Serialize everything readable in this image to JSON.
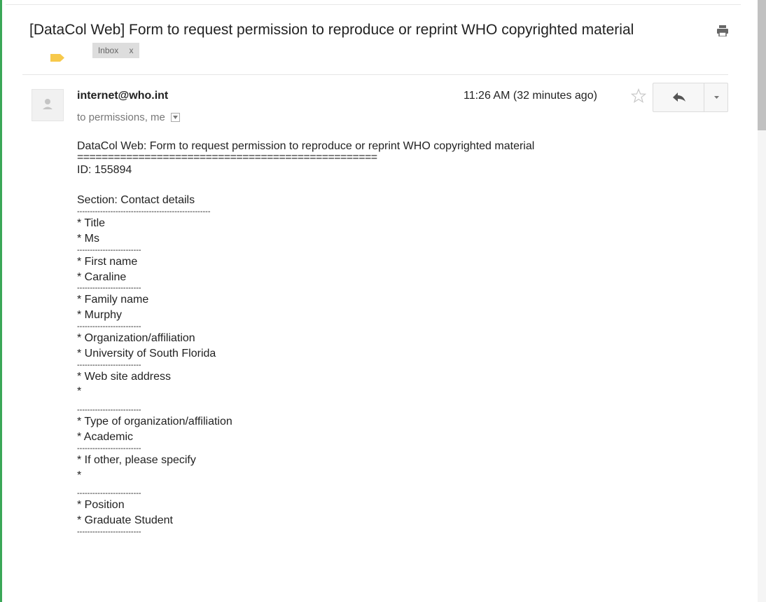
{
  "email": {
    "subject": "[DataCol Web] Form to request permission to reproduce or reprint WHO copyrighted material",
    "inbox_label": "Inbox",
    "inbox_remove": "x",
    "sender": "internet@who.int",
    "recipients": "to permissions, me",
    "time": "11:26 AM (32 minutes ago)",
    "body_heading": "DataCol Web: Form to request permission to reproduce or reprint WHO copyrighted material",
    "double_rule": "=================================================",
    "id_line": "ID: 155894",
    "section_line": "Section: Contact details",
    "section_rule": "----------------------------------------------------",
    "fields": [
      {
        "label": "* Title",
        "value": "* Ms"
      },
      {
        "label": "* First name",
        "value": "* Caraline"
      },
      {
        "label": "* Family name",
        "value": "* Murphy"
      },
      {
        "label": "* Organization/affiliation",
        "value": "* University of South Florida"
      },
      {
        "label": "* Web site address",
        "value": "*"
      },
      {
        "label": "* Type of organization/affiliation",
        "value": "* Academic"
      },
      {
        "label": "* If other, please specify",
        "value": "*"
      },
      {
        "label": "* Position",
        "value": "* Graduate Student"
      }
    ],
    "field_rule": "-------------------------"
  },
  "icons": {
    "label_tag": "label-tag-icon",
    "print": "print-icon",
    "avatar": "person-icon",
    "star": "star-icon",
    "reply": "reply-icon",
    "more": "chevron-down-icon"
  },
  "colors": {
    "accent_rail": "#3aa757",
    "label_tag": "#f7c94b",
    "chip_bg": "#dddddd"
  }
}
